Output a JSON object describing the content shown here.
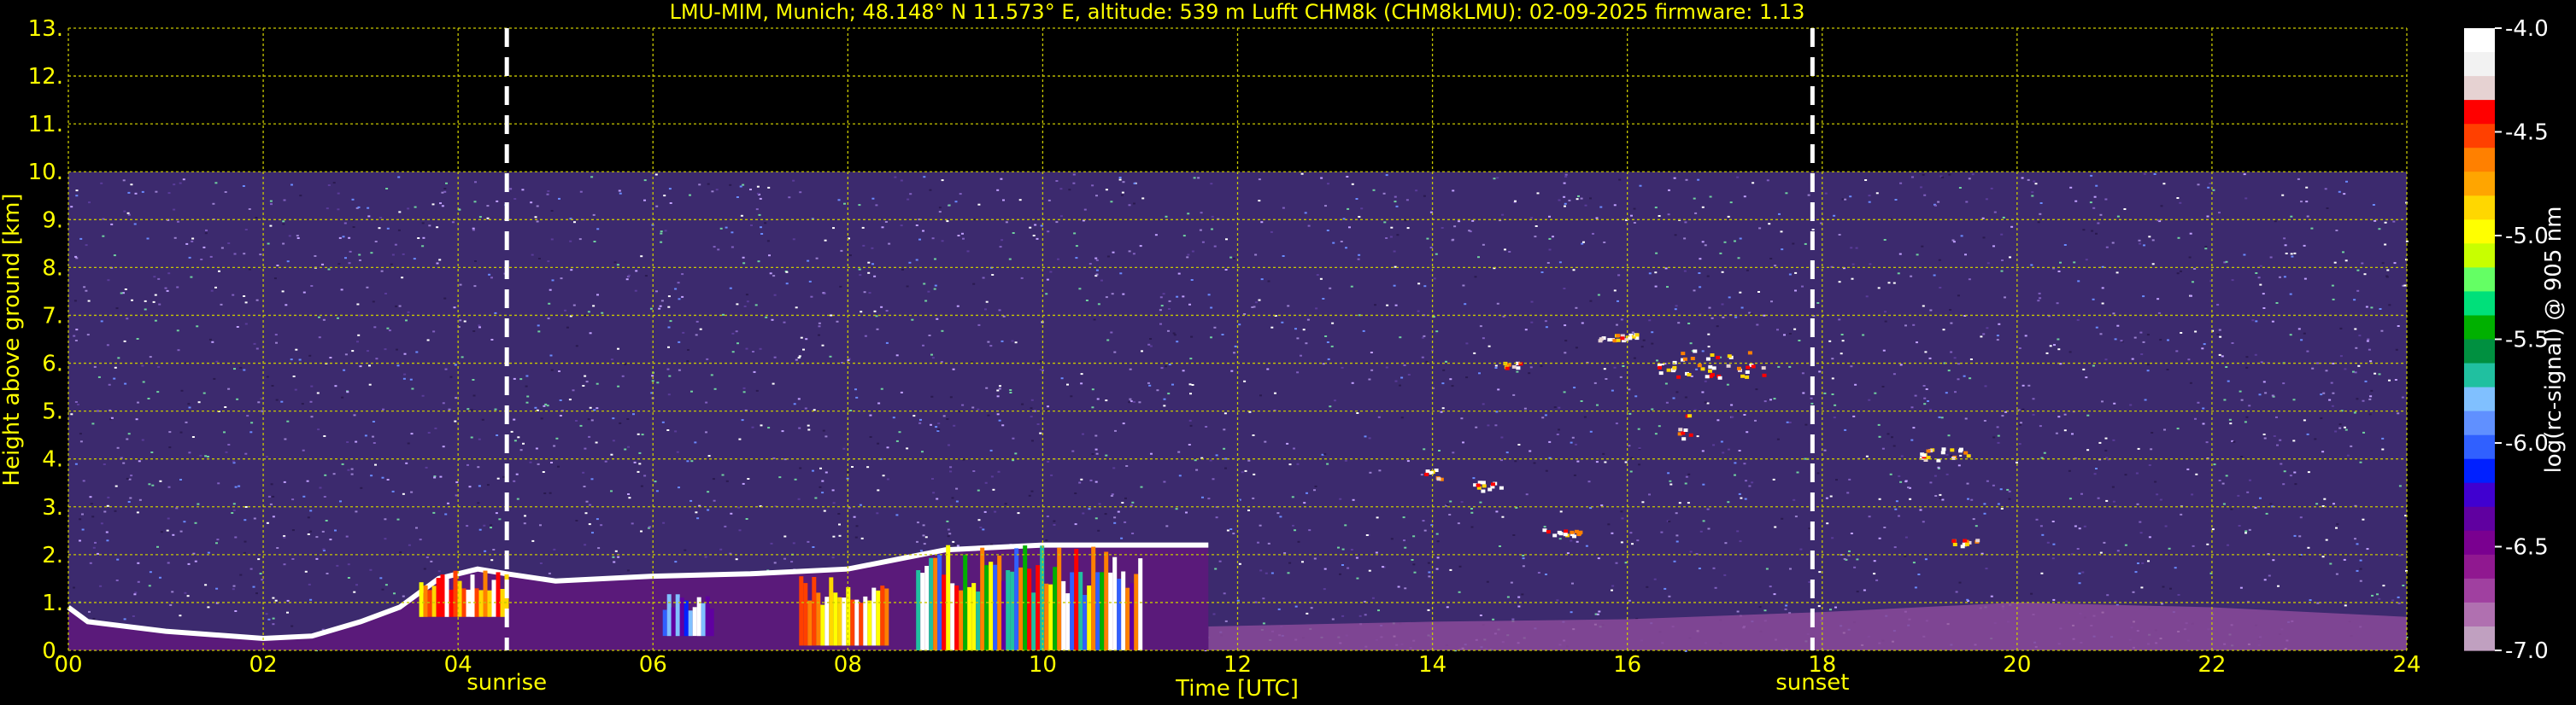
{
  "title": "LMU-MIM, Munich; 48.148° N 11.573° E, altitude: 539 m    Lufft CHM8k (CHM8kLMU): 02-09-2025    firmware: 1.13",
  "colors": {
    "text": "#ffff00",
    "grid": "#c8c800",
    "background": "#000000",
    "noise": "#3c2a6e"
  },
  "chart_data": {
    "type": "heatmap",
    "title": "LMU-MIM, Munich; 48.148° N 11.573° E, altitude: 539 m    Lufft CHM8k (CHM8kLMU): 02-09-2025    firmware: 1.13",
    "xlabel": "Time [UTC]",
    "ylabel": "Height above ground [km]",
    "xlim": [
      0,
      24
    ],
    "ylim": [
      0,
      13
    ],
    "xticks": [
      "00",
      "02",
      "04",
      "06",
      "08",
      "10",
      "12",
      "14",
      "16",
      "18",
      "20",
      "22",
      "24"
    ],
    "yticks": [
      "0.",
      "1.",
      "2.",
      "3.",
      "4.",
      "5.",
      "6.",
      "7.",
      "8.",
      "9.",
      "10.",
      "11.",
      "12.",
      "13."
    ],
    "grid": true,
    "data_top_km": 10,
    "markers": [
      {
        "label": "sunrise",
        "x": 4.5
      },
      {
        "label": "sunset",
        "x": 17.9
      }
    ],
    "colorbar": {
      "label": "log(rc-signal) @ 905 nm",
      "range": [
        -7.0,
        -4.0
      ],
      "ticks": [
        "-4.0",
        "-4.5",
        "-5.0",
        "-5.5",
        "-6.0",
        "-6.5",
        "-7.0"
      ],
      "colors": [
        "#ffffff",
        "#f2f2f2",
        "#e6d2d2",
        "#ff0000",
        "#ff4000",
        "#ff8000",
        "#ffa500",
        "#ffd700",
        "#ffff00",
        "#c8ff00",
        "#64ff64",
        "#00e07a",
        "#00b000",
        "#009040",
        "#20c0a0",
        "#80c0ff",
        "#6090ff",
        "#3060ff",
        "#0020ff",
        "#4000d0",
        "#6000a0",
        "#7a0090",
        "#901890",
        "#a040a0",
        "#b070b0",
        "#c0a0c0"
      ]
    },
    "boundary_layer_top": [
      [
        0,
        0.9
      ],
      [
        0.2,
        0.6
      ],
      [
        1,
        0.4
      ],
      [
        2,
        0.25
      ],
      [
        2.5,
        0.3
      ],
      [
        3,
        0.6
      ],
      [
        3.4,
        0.9
      ],
      [
        3.8,
        1.5
      ],
      [
        4.2,
        1.7
      ],
      [
        4.5,
        1.6
      ],
      [
        5,
        1.45
      ],
      [
        6,
        1.55
      ],
      [
        7,
        1.6
      ],
      [
        8,
        1.7
      ],
      [
        9,
        2.1
      ],
      [
        10,
        2.2
      ],
      [
        11,
        2.2
      ],
      [
        11.7,
        2.2
      ]
    ],
    "cloud_patches": [
      {
        "x": 3.6,
        "y": 0.8,
        "w": 0.9,
        "h": 0.9,
        "palette": "warm"
      },
      {
        "x": 6.1,
        "y": 0.4,
        "w": 0.5,
        "h": 0.8,
        "palette": "cool"
      },
      {
        "x": 7.5,
        "y": 0.2,
        "w": 0.9,
        "h": 1.5,
        "palette": "warm"
      },
      {
        "x": 8.7,
        "y": 0.1,
        "w": 2.3,
        "h": 2.1,
        "palette": "mixed"
      }
    ],
    "aerosol_layers": [
      {
        "x": 14.7,
        "y": 5.9,
        "w": 0.2,
        "h": 0.15
      },
      {
        "x": 15.6,
        "y": 6.5,
        "w": 0.5,
        "h": 0.15
      },
      {
        "x": 16.3,
        "y": 5.7,
        "w": 1.1,
        "h": 0.6
      },
      {
        "x": 16.5,
        "y": 4.4,
        "w": 0.2,
        "h": 0.6
      },
      {
        "x": 13.9,
        "y": 3.6,
        "w": 0.2,
        "h": 0.2
      },
      {
        "x": 14.4,
        "y": 3.35,
        "w": 0.3,
        "h": 0.2
      },
      {
        "x": 15.1,
        "y": 2.4,
        "w": 0.4,
        "h": 0.15
      },
      {
        "x": 19.0,
        "y": 4.0,
        "w": 0.5,
        "h": 0.25
      },
      {
        "x": 19.3,
        "y": 2.2,
        "w": 0.3,
        "h": 0.15
      }
    ],
    "night_aerosol": [
      [
        11.7,
        0.5
      ],
      [
        14,
        0.6
      ],
      [
        16,
        0.65
      ],
      [
        18,
        0.8
      ],
      [
        20,
        1.0
      ],
      [
        22,
        0.9
      ],
      [
        24,
        0.7
      ]
    ]
  }
}
